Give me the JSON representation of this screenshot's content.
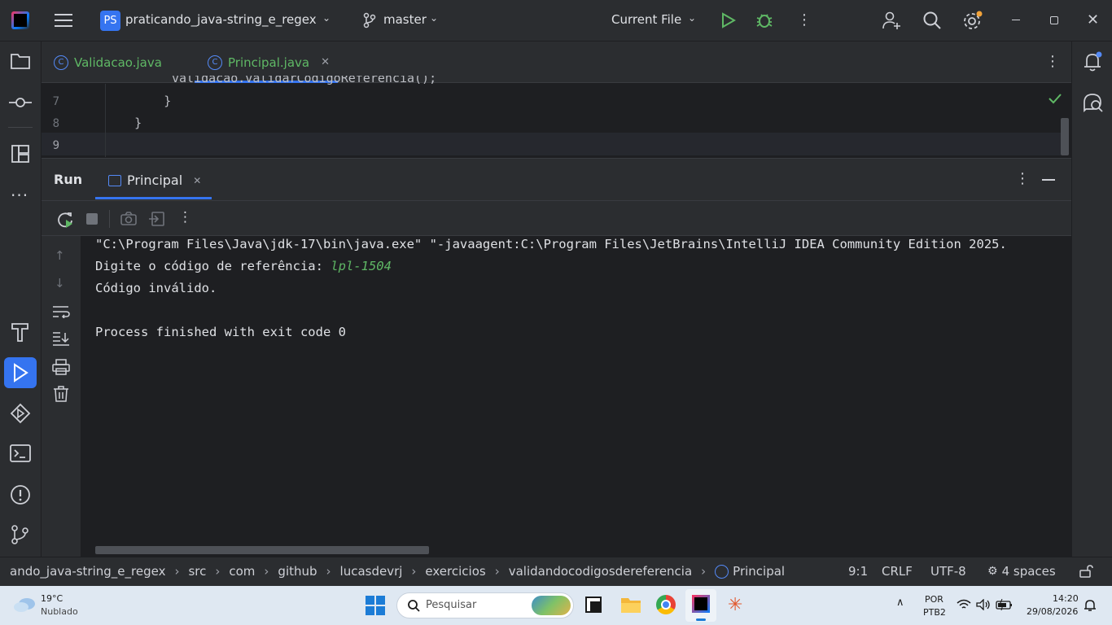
{
  "titlebar": {
    "project_badge": "PS",
    "project_name": "praticando_java-string_e_regex",
    "branch": "master",
    "run_config": "Current File"
  },
  "tabs": [
    {
      "label": "Validacao.java",
      "active": false
    },
    {
      "label": "Principal.java",
      "active": true
    }
  ],
  "editor": {
    "lines": [
      {
        "num": "7",
        "code": "        }"
      },
      {
        "num": "8",
        "code": "    }"
      },
      {
        "num": "9",
        "code": ""
      }
    ]
  },
  "run_panel": {
    "title": "Run",
    "tab_label": "Principal",
    "console": {
      "line1": "\"C:\\Program Files\\Java\\jdk-17\\bin\\java.exe\" \"-javaagent:C:\\Program Files\\JetBrains\\IntelliJ IDEA Community Edition 2025.",
      "prompt": "Digite o código de referência: ",
      "input": "lpl-1504",
      "line3": "Código inválido.",
      "line5": "Process finished with exit code 0"
    }
  },
  "statusbar": {
    "breadcrumbs": [
      "ando_java-string_e_regex",
      "src",
      "com",
      "github",
      "lucasdevrj",
      "exercicios",
      "validandocodigosdereferencia",
      "Principal"
    ],
    "position": "9:1",
    "line_ending": "CRLF",
    "encoding": "UTF-8",
    "indent": "4 spaces"
  },
  "taskbar": {
    "temperature": "19°C",
    "weather": "Nublado",
    "search_placeholder": "Pesquisar",
    "lang_top": "POR",
    "lang_bottom": "PTB2",
    "time": "14:20",
    "date": "29/08/2026"
  },
  "colors": {
    "accent": "#3574f0",
    "run_green": "#5fb865",
    "console_input": "#5fb865"
  }
}
